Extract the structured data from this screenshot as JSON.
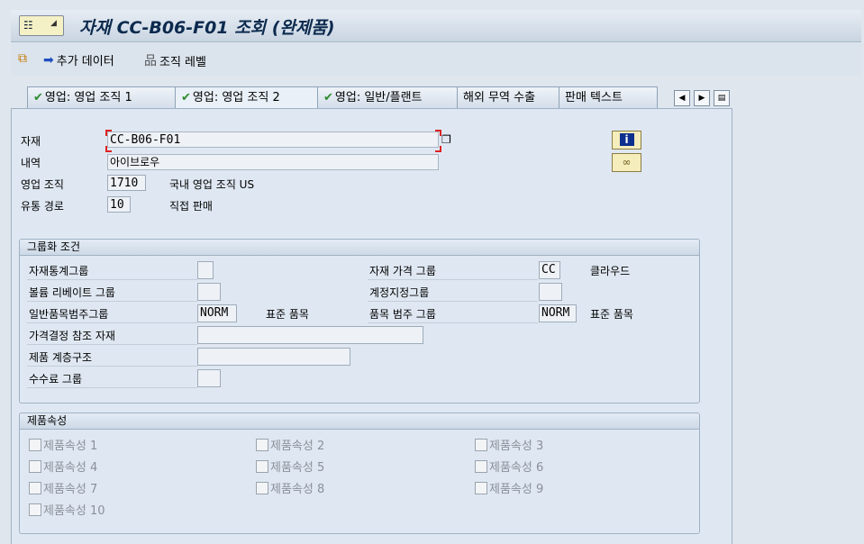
{
  "title": "자재 CC-B06-F01 조회 (완제품)",
  "toolbar": {
    "additional_data": "추가 데이터",
    "org_levels": "조직 레벨"
  },
  "tabs": [
    {
      "label": "영업: 영업 조직 1"
    },
    {
      "label": "영업: 영업 조직 2"
    },
    {
      "label": "영업: 일반/플랜트"
    },
    {
      "label": "해외 무역 수출"
    },
    {
      "label": "판매 텍스트"
    }
  ],
  "header": {
    "material_label": "자재",
    "material_value": "CC-B06-F01",
    "desc_label": "내역",
    "desc_value": "아이브로우",
    "sales_org_label": "영업 조직",
    "sales_org_value": "1710",
    "sales_org_text": "국내 영업 조직 US",
    "dist_channel_label": "유통 경로",
    "dist_channel_value": "10",
    "dist_channel_text": "직접 판매"
  },
  "grouping": {
    "title": "그룹화 조건",
    "mat_stat_group": "자재통계그룹",
    "volume_rebate_group": "볼륨 리베이트 그룹",
    "gen_item_cat_group": "일반품목범주그룹",
    "gen_item_cat_value": "NORM",
    "gen_item_cat_text": "표준 품목",
    "pricing_ref_material": "가격결정 참조 자재",
    "product_hierarchy": "제품 계층구조",
    "commission_group": "수수료 그룹",
    "mat_price_group": "자재 가격 그룹",
    "mat_price_group_value": "CC",
    "mat_price_group_text": "클라우드",
    "acct_assign_group": "계정지정그룹",
    "item_cat_group": "품목 범주 그룹",
    "item_cat_group_value": "NORM",
    "item_cat_group_text": "표준 품목"
  },
  "attributes": {
    "title": "제품속성",
    "items": [
      "제품속성 1",
      "제품속성 2",
      "제품속성 3",
      "제품속성 4",
      "제품속성 5",
      "제품속성 6",
      "제품속성 7",
      "제품속성 8",
      "제품속성 9",
      "제품속성 10"
    ]
  },
  "colors": {
    "title": "#0c2a4e",
    "panel_bg": "#dfe8f2",
    "info_button": "#0d2f8e",
    "required_marker": "#dd2222"
  }
}
